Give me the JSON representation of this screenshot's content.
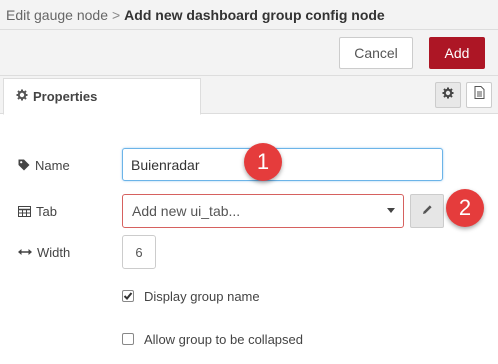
{
  "header": {
    "breadcrumb": "Edit gauge node",
    "separator": ">",
    "title": "Add new dashboard group config node"
  },
  "toolbar": {
    "cancel_label": "Cancel",
    "add_label": "Add",
    "add_color": "#ad1625"
  },
  "tabs": {
    "properties_label": "Properties",
    "properties_icon": "gear-icon",
    "settings_icon": "gear-icon",
    "description_icon": "document-icon"
  },
  "form": {
    "name": {
      "label": "Name",
      "icon": "tag-icon",
      "value": "Buienradar"
    },
    "tab": {
      "label": "Tab",
      "icon": "table-icon",
      "selected": "Add new ui_tab...",
      "edit_icon": "pencil-icon"
    },
    "width": {
      "label": "Width",
      "icon": "arrows-horizontal-icon",
      "value": "6"
    },
    "display_group_name": {
      "label": "Display group name",
      "checked": true
    },
    "allow_collapse": {
      "label": "Allow group to be collapsed",
      "checked": false
    }
  },
  "annotations": {
    "marker_1": "1",
    "marker_2": "2",
    "marker_color": "#e53c3c"
  }
}
